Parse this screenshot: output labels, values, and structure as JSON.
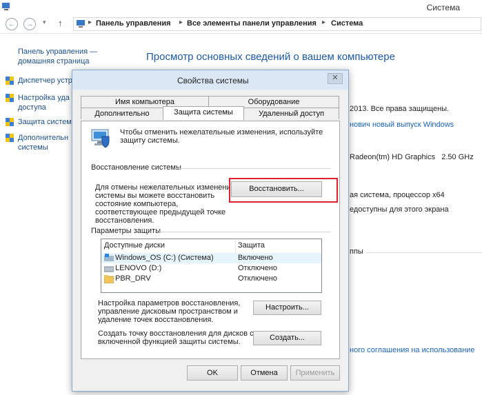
{
  "window": {
    "title": "Система"
  },
  "nav": {
    "back": "←",
    "forward": "→",
    "dropdown": "▾",
    "up": "↑",
    "breadcrumb": [
      "Панель управления",
      "Все элементы панели управления",
      "Система"
    ]
  },
  "sidebar": {
    "home_line1": "Панель управления —",
    "home_line2": "домашняя страница",
    "items": [
      {
        "label": "Диспетчер устр"
      },
      {
        "label_line1": "Настройка уда",
        "label_line2": "доступа"
      },
      {
        "label": "Защита систем"
      },
      {
        "label_line1": "Дополнительн",
        "label_line2": "системы"
      }
    ]
  },
  "main": {
    "title": "Просмотр основных сведений о вашем компьютере",
    "copyright": "2013. Все права защищены.",
    "new_release_link": "нович новый выпуск Windows",
    "processor": "Radeon(tm) HD Graphics   2.50 GHz",
    "system_type": "ая система, процессор x64",
    "pen_touch": "едоступны для этого экрана",
    "group_label": "ппы",
    "license_link": "ного соглашения на использование"
  },
  "dialog": {
    "title": "Свойства системы",
    "close": "✕",
    "tabs_top": [
      "Имя компьютера",
      "Оборудование"
    ],
    "tabs_bottom": [
      "Дополнительно",
      "Защита системы",
      "Удаленный доступ"
    ],
    "intro_line1": "Чтобы отменить нежелательные изменения, используйте",
    "intro_line2": "защиту системы.",
    "restore_group": "Восстановление системы",
    "restore_text": [
      "Для отмены нежелательных изменений",
      "системы вы можете восстановить",
      "состояние компьютера,",
      "соответствующее предыдущей точке",
      "восстановления."
    ],
    "restore_button": "Восстановить...",
    "protection_group": "Параметры защиты",
    "list_headers": [
      "Доступные диски",
      "Защита"
    ],
    "drives": [
      {
        "name": "Windows_OS (C:) (Система)",
        "status": "Включено"
      },
      {
        "name": "LENOVO (D:)",
        "status": "Отключено"
      },
      {
        "name": "PBR_DRV",
        "status": "Отключено"
      }
    ],
    "configure_text": [
      "Настройка параметров восстановления,",
      "управление дисковым пространством и",
      "удаление точек восстановления."
    ],
    "configure_button": "Настроить...",
    "create_text": [
      "Создать точку восстановления для дисков с",
      "включенной функцией защиты системы."
    ],
    "create_button": "Создать...",
    "ok": "OK",
    "cancel": "Отмена",
    "apply": "Применить"
  }
}
